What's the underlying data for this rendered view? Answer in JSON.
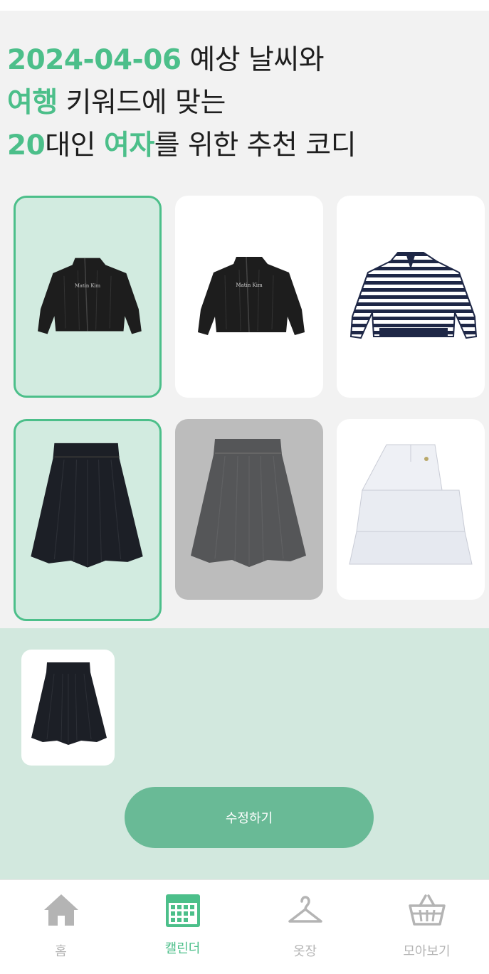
{
  "headline": {
    "date": "2024-04-06",
    "line1_rest": " 예상 날씨와",
    "keyword": "여행",
    "line2_rest": " 키워드에 맞는",
    "age": "20",
    "line3_mid": "대인 ",
    "gender": "여자",
    "line3_rest": "를 위한 추천 코디"
  },
  "items": {
    "row1": [
      {
        "name": "black-jacket-item",
        "state": "selected",
        "brand_text": "Matin Kim"
      },
      {
        "name": "black-jacket-item",
        "state": "normal",
        "brand_text": "Matin Kim"
      },
      {
        "name": "striped-sweater-item",
        "state": "normal"
      }
    ],
    "row2": [
      {
        "name": "black-skirt-item",
        "state": "selected"
      },
      {
        "name": "gray-skirt-item",
        "state": "dimmed"
      },
      {
        "name": "white-tiered-skirt-item",
        "state": "normal"
      }
    ]
  },
  "selection": {
    "thumbs": [
      "black-skirt-thumb"
    ],
    "edit_button": "수정하기"
  },
  "nav": [
    {
      "label": "홈",
      "icon": "home-icon",
      "active": false
    },
    {
      "label": "캘린더",
      "icon": "calendar-icon",
      "active": true
    },
    {
      "label": "옷장",
      "icon": "hanger-icon",
      "active": false
    },
    {
      "label": "모아보기",
      "icon": "basket-icon",
      "active": false
    }
  ],
  "colors": {
    "accent": "#4cbf8a",
    "selected_bg": "#d2ebe0",
    "panel_bg": "#d2e8de",
    "button_bg": "#69ba96",
    "inactive": "#b4b4b4"
  }
}
